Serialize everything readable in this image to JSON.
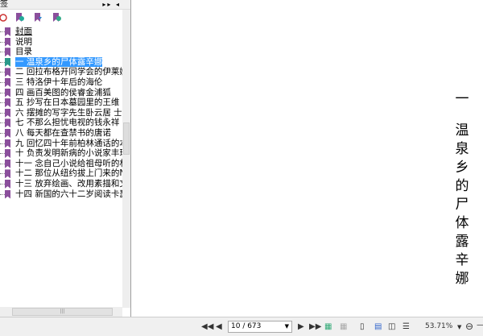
{
  "panel": {
    "title": "签",
    "collapse_label": "▸▸ ◂"
  },
  "bookmarks": [
    "封面",
    "说明",
    "目录",
    "一 温泉乡的尸体露辛娜",
    "二 回拉布格开同学会的伊莱娜",
    "三 特洛伊十年后的海伦",
    "四 画百美图的侯睿金浦狐",
    "五 抄写在日本墓园里的王维",
    "六 摆摊的写字先生卧云居 士",
    "七 不那么担忧电视的钱永祥",
    "八 每天都在查禁书的唐诺",
    "九 回忆四十年前柏林通话的本雅明",
    "十 负责发明新病的小说家丰玮",
    "十一 念自己小说给祖母听的林俊颖",
    "十二 那位从纽约拔上门来的NBA迷",
    "十三 放弃绘画、改用素描和文字的汶",
    "十四 新国的六十二岁阅读卡瑟尔"
  ],
  "selected_index": 3,
  "document": {
    "chapter_num": "一",
    "chapter_title": "温泉乡的尸体露辛娜"
  },
  "toolbar": {
    "page": "10 / 673",
    "zoom": "53.71%"
  },
  "colors": {
    "bookmark": "#8b4f9c",
    "selected": "#3399ff"
  }
}
